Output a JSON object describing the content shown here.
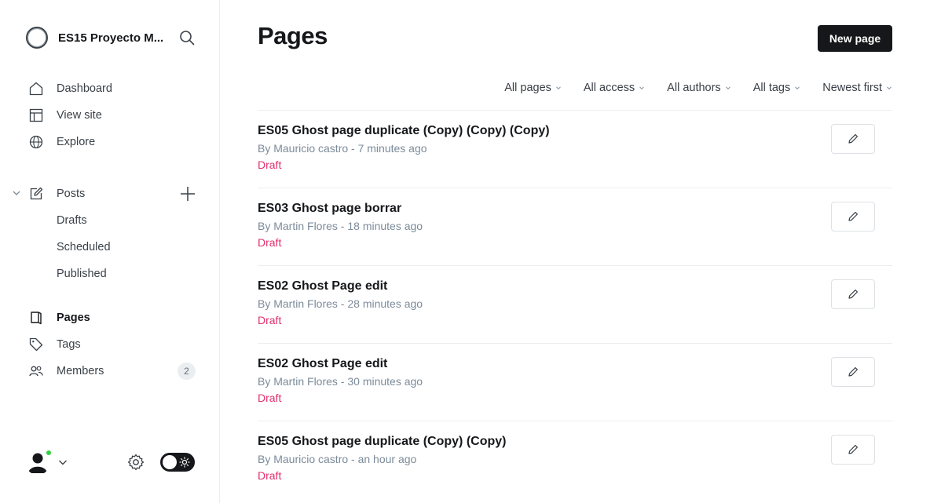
{
  "sidebar": {
    "site_title": "ES15 Proyecto M...",
    "nav": [
      {
        "label": "Dashboard",
        "icon": "home-icon"
      },
      {
        "label": "View site",
        "icon": "layout-icon"
      },
      {
        "label": "Explore",
        "icon": "globe-icon"
      }
    ],
    "posts": {
      "label": "Posts",
      "icon": "edit-icon",
      "sub_items": [
        "Drafts",
        "Scheduled",
        "Published"
      ]
    },
    "nav2": [
      {
        "label": "Pages",
        "icon": "page-icon",
        "active": true
      },
      {
        "label": "Tags",
        "icon": "tag-icon"
      },
      {
        "label": "Members",
        "icon": "members-icon",
        "badge": "2"
      }
    ]
  },
  "main": {
    "title": "Pages",
    "new_page_label": "New page",
    "filters": [
      "All pages",
      "All access",
      "All authors",
      "All tags",
      "Newest first"
    ],
    "pages": [
      {
        "title": "ES05 Ghost page duplicate (Copy) (Copy) (Copy)",
        "meta": "By Mauricio castro - 7 minutes ago",
        "status": "Draft"
      },
      {
        "title": "ES03 Ghost page borrar",
        "meta": "By Martin Flores - 18 minutes ago",
        "status": "Draft"
      },
      {
        "title": "ES02 Ghost Page edit",
        "meta": "By Martin Flores - 28 minutes ago",
        "status": "Draft"
      },
      {
        "title": "ES02 Ghost Page edit",
        "meta": "By Martin Flores - 30 minutes ago",
        "status": "Draft"
      },
      {
        "title": "ES05 Ghost page duplicate (Copy) (Copy)",
        "meta": "By Mauricio castro - an hour ago",
        "status": "Draft"
      }
    ]
  },
  "colors": {
    "accent_dark": "#15171a",
    "draft": "#e2316b",
    "online": "#30cf43"
  }
}
